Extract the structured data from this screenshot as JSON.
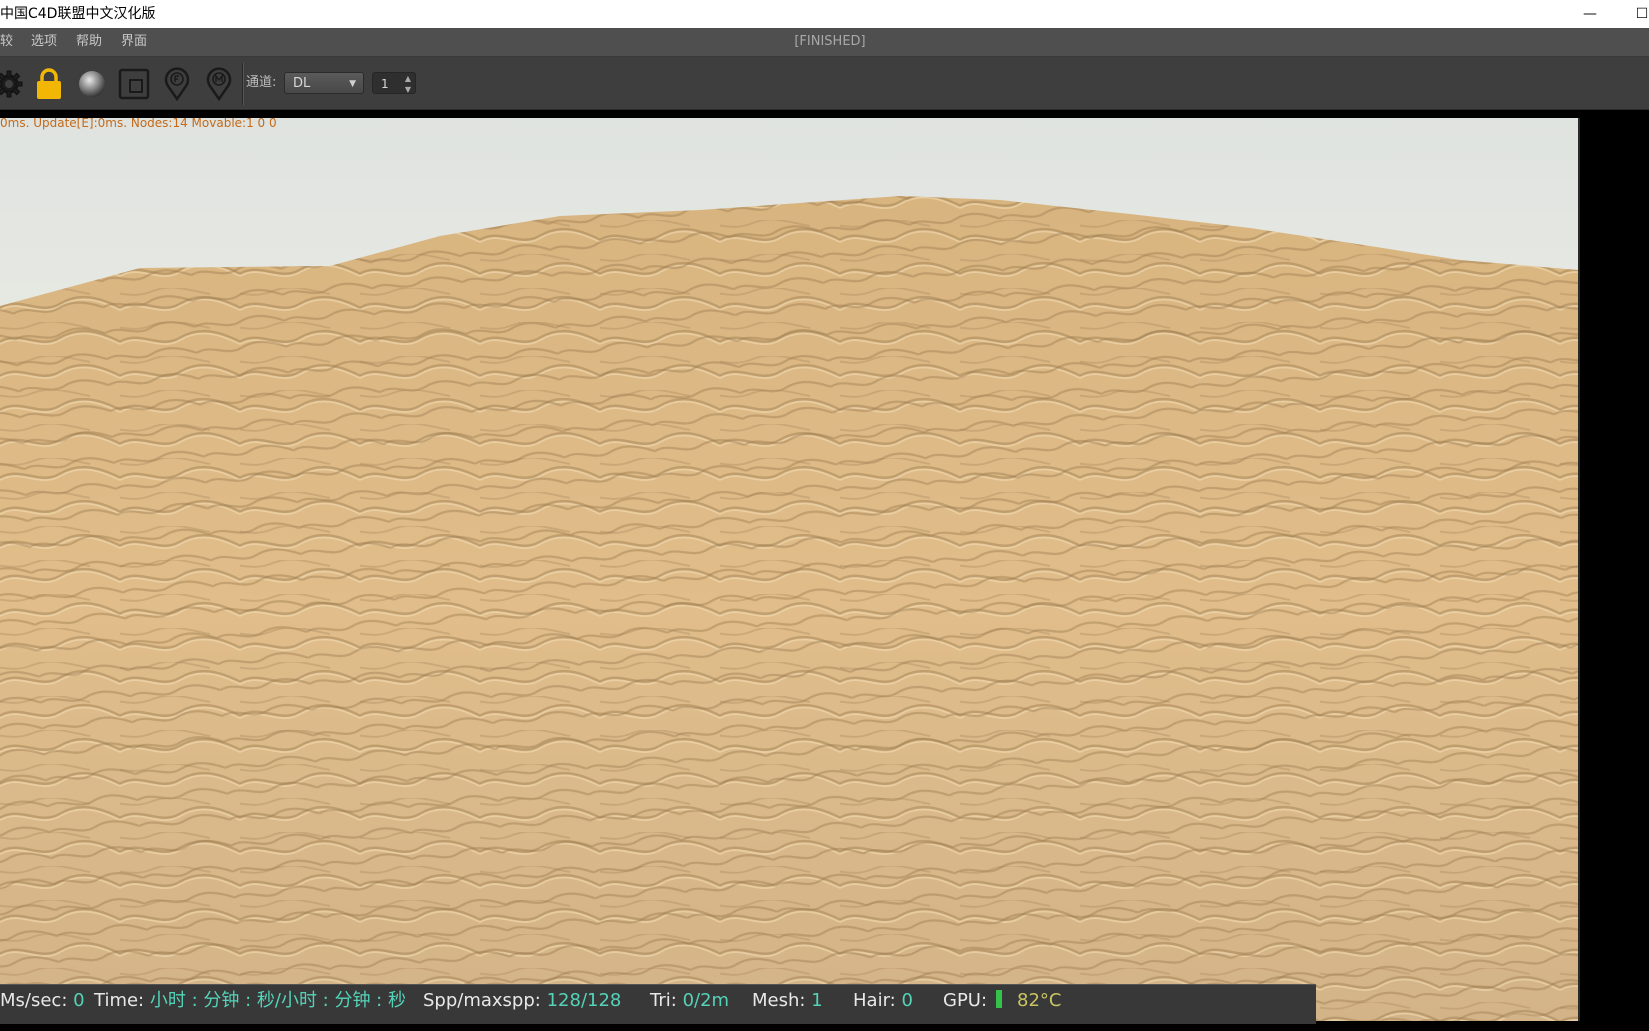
{
  "window": {
    "title": "中国C4D联盟中文汉化版",
    "minimize_glyph": "—",
    "maximize_glyph": "☐"
  },
  "menu": {
    "items": [
      "较",
      "选项",
      "帮助",
      "界面"
    ],
    "status": "[FINISHED]"
  },
  "toolbar": {
    "icons": [
      "gear-icon",
      "lock-icon",
      "material-ball-icon",
      "region-render-icon",
      "pin-f-icon",
      "pin-m-icon"
    ],
    "lock_color": "#f2b705",
    "channel_label": "通道:",
    "channel_value": "DL",
    "layer_value": "1"
  },
  "viewport": {
    "debug_text": "0ms. Update[E]:0ms. Nodes:14 Movable:1  0 0"
  },
  "status": {
    "ms_label": "Ms/sec:",
    "ms_value": "0",
    "time_label": "Time:",
    "time_value": "小时 : 分钟 : 秒/小时 : 分钟 : 秒",
    "spp_label": "Spp/maxspp:",
    "spp_value": "128/128",
    "tri_label": "Tri:",
    "tri_value": "0/2m",
    "mesh_label": "Mesh:",
    "mesh_value": "1",
    "hair_label": "Hair:",
    "hair_value": "0",
    "gpu_label": "GPU:",
    "temp_value": "82°C"
  }
}
